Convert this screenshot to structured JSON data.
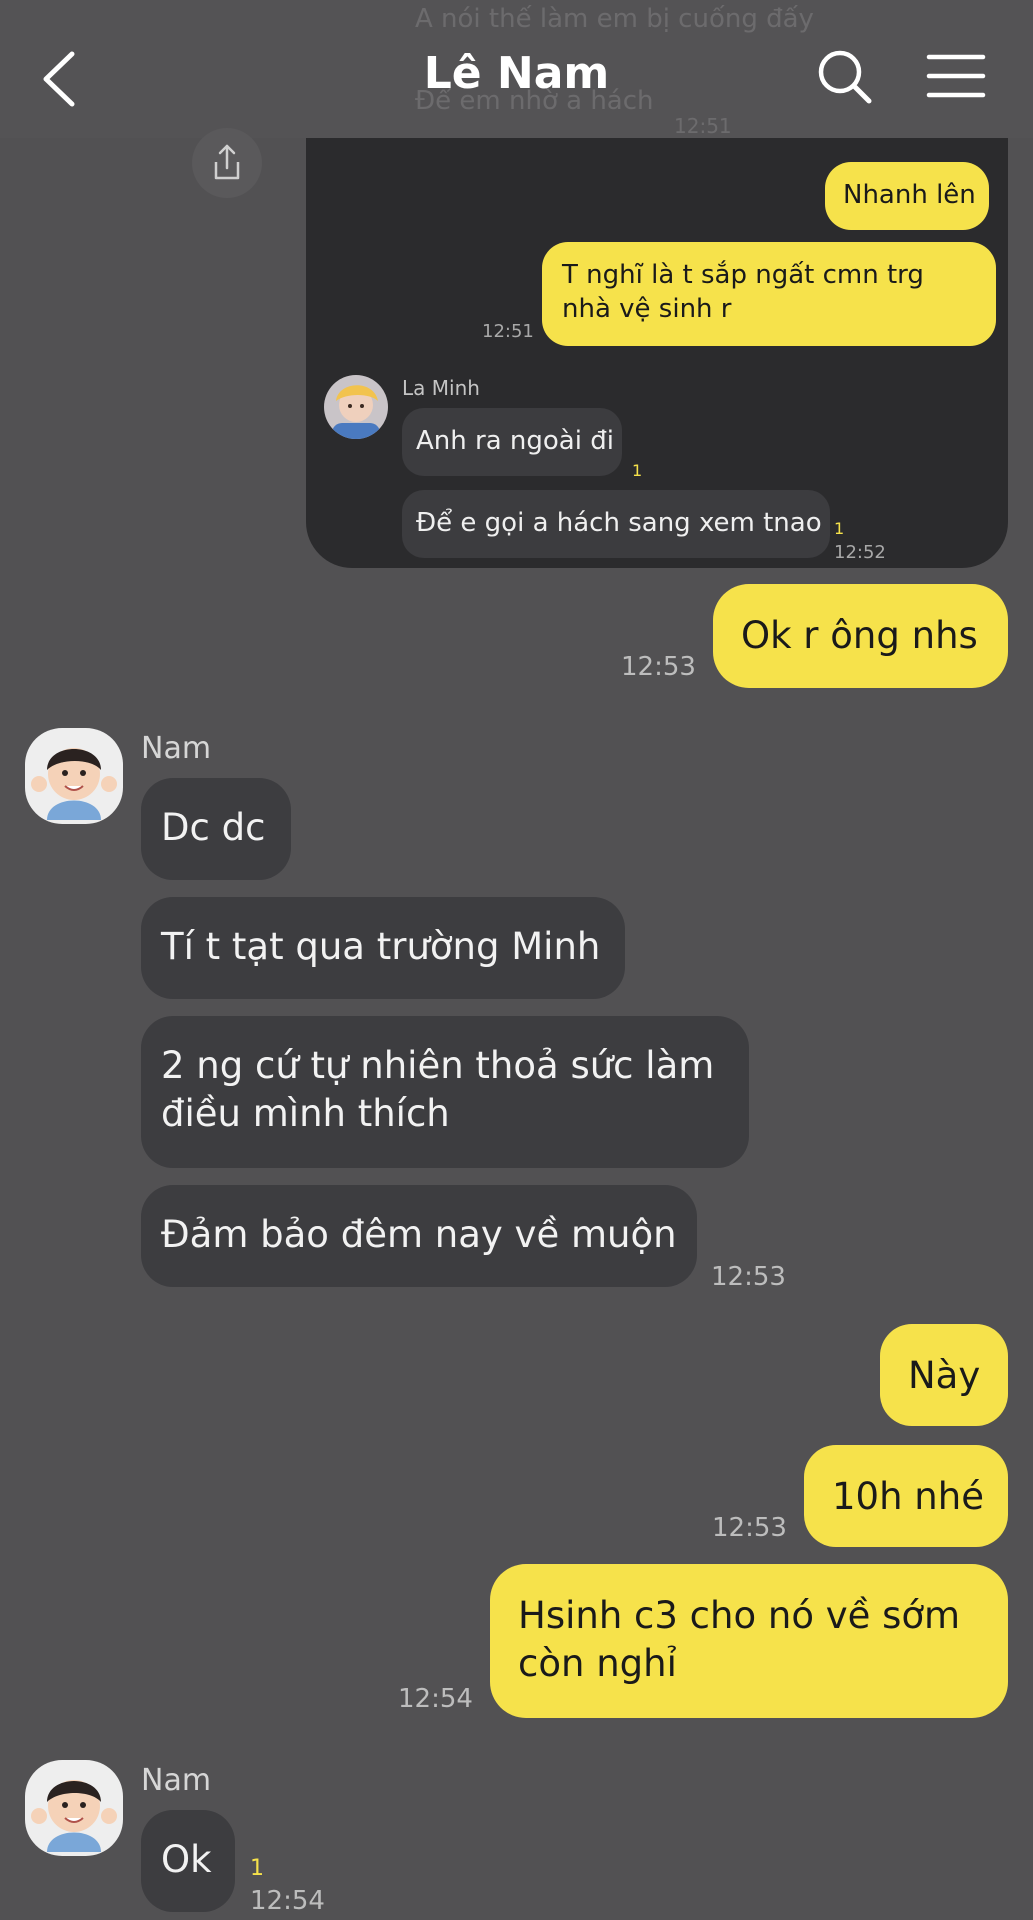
{
  "header": {
    "title": "Lê Nam",
    "faded_line_1": "A nói thế làm em bị cuống đấy",
    "faded_line_2": "Để em nhờ a hách",
    "faded_time": "12:51"
  },
  "screenshot_card": {
    "messages_out": [
      {
        "text": "Nhanh lên"
      },
      {
        "text": "T nghĩ là t sắp ngất cmn trg nhà vệ sinh r",
        "time": "12:51"
      }
    ],
    "sender_name": "La Minh",
    "messages_in": [
      {
        "text": "Anh ra ngoài đi",
        "unread": "1"
      },
      {
        "text": "Để e gọi a hách sang xem tnao",
        "unread": "1",
        "time": "12:52"
      }
    ]
  },
  "messages": [
    {
      "id": "m1",
      "side": "out",
      "text": "Ok r ông nhs",
      "time": "12:53"
    },
    {
      "id": "m2",
      "side": "in",
      "sender": "Nam",
      "text": "Dc dc"
    },
    {
      "id": "m3",
      "side": "in",
      "text": "Tí t tạt qua trường Minh"
    },
    {
      "id": "m4",
      "side": "in",
      "text": "2 ng cứ tự nhiên thoả sức làm điều mình thích"
    },
    {
      "id": "m5",
      "side": "in",
      "text": "Đảm bảo đêm nay về muộn",
      "time": "12:53"
    },
    {
      "id": "m6",
      "side": "out",
      "text": "Này"
    },
    {
      "id": "m7",
      "side": "out",
      "text": "10h nhé",
      "time": "12:53"
    },
    {
      "id": "m8",
      "side": "out",
      "text": "Hsinh c3 cho nó về sớm còn nghỉ",
      "time": "12:54"
    },
    {
      "id": "m9",
      "side": "in",
      "sender": "Nam",
      "text": "Ok",
      "unread": "1",
      "time": "12:54"
    }
  ],
  "icons": {
    "back": "chevron-left-icon",
    "search": "search-icon",
    "menu": "menu-icon",
    "share": "share-icon"
  },
  "colors": {
    "background": "#525153",
    "outgoing_bubble": "#f6e24b",
    "incoming_bubble": "#3d3d40",
    "card_background": "#2b2b2d",
    "unread_count": "#f6e24b"
  }
}
